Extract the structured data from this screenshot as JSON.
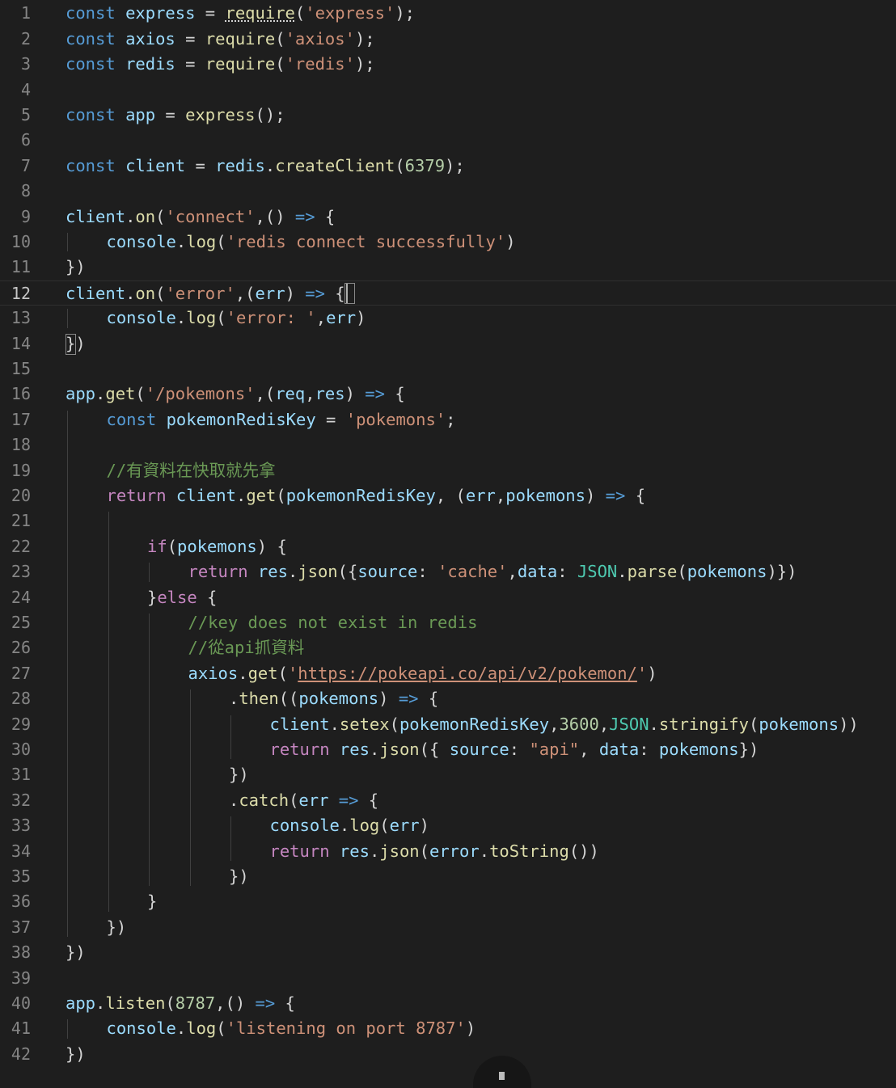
{
  "editor": {
    "language": "javascript",
    "current_line": 12,
    "colors": {
      "background": "#1e1e1e",
      "line_number": "#858585",
      "keyword": "#569cd6",
      "control_keyword": "#c586c0",
      "variable": "#9cdcfe",
      "function": "#dcdcaa",
      "string": "#ce9178",
      "number": "#b5cea8",
      "comment": "#6a9955",
      "constant": "#4ec9b0"
    },
    "lines": [
      {
        "n": "1",
        "indent": 0,
        "tokens": [
          [
            "kw",
            "const "
          ],
          [
            "var",
            "express"
          ],
          [
            "op",
            " = "
          ],
          [
            "fn",
            "require",
            "sq"
          ],
          [
            "op",
            "("
          ],
          [
            "str",
            "'express'"
          ],
          [
            "op",
            ");"
          ]
        ]
      },
      {
        "n": "2",
        "indent": 0,
        "tokens": [
          [
            "kw",
            "const "
          ],
          [
            "var",
            "axios"
          ],
          [
            "op",
            " = "
          ],
          [
            "fn",
            "require"
          ],
          [
            "op",
            "("
          ],
          [
            "str",
            "'axios'"
          ],
          [
            "op",
            ");"
          ]
        ]
      },
      {
        "n": "3",
        "indent": 0,
        "tokens": [
          [
            "kw",
            "const "
          ],
          [
            "var",
            "redis"
          ],
          [
            "op",
            " = "
          ],
          [
            "fn",
            "require"
          ],
          [
            "op",
            "("
          ],
          [
            "str",
            "'redis'"
          ],
          [
            "op",
            ");"
          ]
        ]
      },
      {
        "n": "4",
        "indent": 0,
        "tokens": []
      },
      {
        "n": "5",
        "indent": 0,
        "tokens": [
          [
            "kw",
            "const "
          ],
          [
            "var",
            "app"
          ],
          [
            "op",
            " = "
          ],
          [
            "fn",
            "express"
          ],
          [
            "op",
            "();"
          ]
        ]
      },
      {
        "n": "6",
        "indent": 0,
        "tokens": []
      },
      {
        "n": "7",
        "indent": 0,
        "tokens": [
          [
            "kw",
            "const "
          ],
          [
            "var",
            "client"
          ],
          [
            "op",
            " = "
          ],
          [
            "var",
            "redis"
          ],
          [
            "op",
            "."
          ],
          [
            "fn",
            "createClient"
          ],
          [
            "op",
            "("
          ],
          [
            "num",
            "6379"
          ],
          [
            "op",
            ");"
          ]
        ]
      },
      {
        "n": "8",
        "indent": 0,
        "tokens": []
      },
      {
        "n": "9",
        "indent": 0,
        "tokens": [
          [
            "var",
            "client"
          ],
          [
            "op",
            "."
          ],
          [
            "fn",
            "on"
          ],
          [
            "op",
            "("
          ],
          [
            "str",
            "'connect'"
          ],
          [
            "op",
            ",() "
          ],
          [
            "kw",
            "=>"
          ],
          [
            "op",
            " {"
          ]
        ]
      },
      {
        "n": "10",
        "indent": 1,
        "tokens": [
          [
            "var",
            "console"
          ],
          [
            "op",
            "."
          ],
          [
            "fn",
            "log"
          ],
          [
            "op",
            "("
          ],
          [
            "str",
            "'redis connect successfully'"
          ],
          [
            "op",
            ")"
          ]
        ]
      },
      {
        "n": "11",
        "indent": 0,
        "tokens": [
          [
            "op",
            "})"
          ]
        ]
      },
      {
        "n": "12",
        "indent": 0,
        "tokens": [
          [
            "var",
            "client"
          ],
          [
            "op",
            "."
          ],
          [
            "fn",
            "on"
          ],
          [
            "op",
            "("
          ],
          [
            "str",
            "'error'"
          ],
          [
            "op",
            ",("
          ],
          [
            "var",
            "err"
          ],
          [
            "op",
            ") "
          ],
          [
            "kw",
            "=>"
          ],
          [
            "op",
            " {"
          ]
        ]
      },
      {
        "n": "13",
        "indent": 1,
        "tokens": [
          [
            "var",
            "console"
          ],
          [
            "op",
            "."
          ],
          [
            "fn",
            "log"
          ],
          [
            "op",
            "("
          ],
          [
            "str",
            "'error: '"
          ],
          [
            "op",
            ","
          ],
          [
            "var",
            "err"
          ],
          [
            "op",
            ")"
          ]
        ]
      },
      {
        "n": "14",
        "indent": 0,
        "tokens": [
          [
            "op",
            "})"
          ]
        ]
      },
      {
        "n": "15",
        "indent": 0,
        "tokens": []
      },
      {
        "n": "16",
        "indent": 0,
        "tokens": [
          [
            "var",
            "app"
          ],
          [
            "op",
            "."
          ],
          [
            "fn",
            "get"
          ],
          [
            "op",
            "("
          ],
          [
            "str",
            "'/pokemons'"
          ],
          [
            "op",
            ",("
          ],
          [
            "var",
            "req"
          ],
          [
            "op",
            ","
          ],
          [
            "var",
            "res"
          ],
          [
            "op",
            ") "
          ],
          [
            "kw",
            "=>"
          ],
          [
            "op",
            " {"
          ]
        ]
      },
      {
        "n": "17",
        "indent": 1,
        "tokens": [
          [
            "kw",
            "const "
          ],
          [
            "var",
            "pokemonRedisKey"
          ],
          [
            "op",
            " = "
          ],
          [
            "str",
            "'pokemons'"
          ],
          [
            "op",
            ";"
          ]
        ]
      },
      {
        "n": "18",
        "indent": 1,
        "tokens": []
      },
      {
        "n": "19",
        "indent": 1,
        "tokens": [
          [
            "cmt",
            "//有資料在快取就先拿"
          ]
        ]
      },
      {
        "n": "20",
        "indent": 1,
        "tokens": [
          [
            "kw2",
            "return "
          ],
          [
            "var",
            "client"
          ],
          [
            "op",
            "."
          ],
          [
            "fn",
            "get"
          ],
          [
            "op",
            "("
          ],
          [
            "var",
            "pokemonRedisKey"
          ],
          [
            "op",
            ", ("
          ],
          [
            "var",
            "err"
          ],
          [
            "op",
            ","
          ],
          [
            "var",
            "pokemons"
          ],
          [
            "op",
            ") "
          ],
          [
            "kw",
            "=>"
          ],
          [
            "op",
            " {"
          ]
        ]
      },
      {
        "n": "21",
        "indent": 2,
        "tokens": []
      },
      {
        "n": "22",
        "indent": 2,
        "tokens": [
          [
            "kw2",
            "if"
          ],
          [
            "op",
            "("
          ],
          [
            "var",
            "pokemons"
          ],
          [
            "op",
            ") {"
          ]
        ]
      },
      {
        "n": "23",
        "indent": 3,
        "tokens": [
          [
            "kw2",
            "return "
          ],
          [
            "var",
            "res"
          ],
          [
            "op",
            "."
          ],
          [
            "fn",
            "json"
          ],
          [
            "op",
            "({"
          ],
          [
            "var",
            "source"
          ],
          [
            "op",
            ": "
          ],
          [
            "str",
            "'cache'"
          ],
          [
            "op",
            ","
          ],
          [
            "var",
            "data"
          ],
          [
            "op",
            ": "
          ],
          [
            "const",
            "JSON"
          ],
          [
            "op",
            "."
          ],
          [
            "fn",
            "parse"
          ],
          [
            "op",
            "("
          ],
          [
            "var",
            "pokemons"
          ],
          [
            "op",
            ")})"
          ]
        ]
      },
      {
        "n": "24",
        "indent": 2,
        "tokens": [
          [
            "op",
            "}"
          ],
          [
            "kw2",
            "else"
          ],
          [
            "op",
            " {"
          ]
        ]
      },
      {
        "n": "25",
        "indent": 3,
        "tokens": [
          [
            "cmt",
            "//key does not exist in redis"
          ]
        ]
      },
      {
        "n": "26",
        "indent": 3,
        "tokens": [
          [
            "cmt",
            "//從api抓資料"
          ]
        ]
      },
      {
        "n": "27",
        "indent": 3,
        "tokens": [
          [
            "var",
            "axios"
          ],
          [
            "op",
            "."
          ],
          [
            "fn",
            "get"
          ],
          [
            "op",
            "("
          ],
          [
            "str",
            "'"
          ],
          [
            "url",
            "https://pokeapi.co/api/v2/pokemon/"
          ],
          [
            "str",
            "'"
          ],
          [
            "op",
            ")"
          ]
        ]
      },
      {
        "n": "28",
        "indent": 4,
        "tokens": [
          [
            "op",
            "."
          ],
          [
            "fn",
            "then"
          ],
          [
            "op",
            "(("
          ],
          [
            "var",
            "pokemons"
          ],
          [
            "op",
            ") "
          ],
          [
            "kw",
            "=>"
          ],
          [
            "op",
            " {"
          ]
        ]
      },
      {
        "n": "29",
        "indent": 5,
        "tokens": [
          [
            "var",
            "client"
          ],
          [
            "op",
            "."
          ],
          [
            "fn",
            "setex"
          ],
          [
            "op",
            "("
          ],
          [
            "var",
            "pokemonRedisKey"
          ],
          [
            "op",
            ","
          ],
          [
            "num",
            "3600"
          ],
          [
            "op",
            ","
          ],
          [
            "const",
            "JSON"
          ],
          [
            "op",
            "."
          ],
          [
            "fn",
            "stringify"
          ],
          [
            "op",
            "("
          ],
          [
            "var",
            "pokemons"
          ],
          [
            "op",
            "))"
          ]
        ]
      },
      {
        "n": "30",
        "indent": 5,
        "tokens": [
          [
            "kw2",
            "return "
          ],
          [
            "var",
            "res"
          ],
          [
            "op",
            "."
          ],
          [
            "fn",
            "json"
          ],
          [
            "op",
            "({ "
          ],
          [
            "var",
            "source"
          ],
          [
            "op",
            ": "
          ],
          [
            "str",
            "\"api\""
          ],
          [
            "op",
            ", "
          ],
          [
            "var",
            "data"
          ],
          [
            "op",
            ": "
          ],
          [
            "var",
            "pokemons"
          ],
          [
            "op",
            "})"
          ]
        ]
      },
      {
        "n": "31",
        "indent": 4,
        "tokens": [
          [
            "op",
            "})"
          ]
        ]
      },
      {
        "n": "32",
        "indent": 4,
        "tokens": [
          [
            "op",
            "."
          ],
          [
            "fn",
            "catch"
          ],
          [
            "op",
            "("
          ],
          [
            "var",
            "err"
          ],
          [
            "op",
            " "
          ],
          [
            "kw",
            "=>"
          ],
          [
            "op",
            " {"
          ]
        ]
      },
      {
        "n": "33",
        "indent": 5,
        "tokens": [
          [
            "var",
            "console"
          ],
          [
            "op",
            "."
          ],
          [
            "fn",
            "log"
          ],
          [
            "op",
            "("
          ],
          [
            "var",
            "err"
          ],
          [
            "op",
            ")"
          ]
        ]
      },
      {
        "n": "34",
        "indent": 5,
        "tokens": [
          [
            "kw2",
            "return "
          ],
          [
            "var",
            "res"
          ],
          [
            "op",
            "."
          ],
          [
            "fn",
            "json"
          ],
          [
            "op",
            "("
          ],
          [
            "var",
            "error"
          ],
          [
            "op",
            "."
          ],
          [
            "fn",
            "toString"
          ],
          [
            "op",
            "())"
          ]
        ]
      },
      {
        "n": "35",
        "indent": 4,
        "tokens": [
          [
            "op",
            "})"
          ]
        ]
      },
      {
        "n": "36",
        "indent": 2,
        "tokens": [
          [
            "op",
            "}"
          ]
        ]
      },
      {
        "n": "37",
        "indent": 1,
        "tokens": [
          [
            "op",
            "})"
          ]
        ]
      },
      {
        "n": "38",
        "indent": 0,
        "tokens": [
          [
            "op",
            "})"
          ]
        ]
      },
      {
        "n": "39",
        "indent": 0,
        "tokens": []
      },
      {
        "n": "40",
        "indent": 0,
        "tokens": [
          [
            "var",
            "app"
          ],
          [
            "op",
            "."
          ],
          [
            "fn",
            "listen"
          ],
          [
            "op",
            "("
          ],
          [
            "num",
            "8787"
          ],
          [
            "op",
            ",() "
          ],
          [
            "kw",
            "=>"
          ],
          [
            "op",
            " {"
          ]
        ]
      },
      {
        "n": "41",
        "indent": 1,
        "tokens": [
          [
            "var",
            "console"
          ],
          [
            "op",
            "."
          ],
          [
            "fn",
            "log"
          ],
          [
            "op",
            "("
          ],
          [
            "str",
            "'listening on port 8787'"
          ],
          [
            "op",
            ")"
          ]
        ]
      },
      {
        "n": "42",
        "indent": 0,
        "tokens": [
          [
            "op",
            "})"
          ]
        ]
      }
    ]
  }
}
